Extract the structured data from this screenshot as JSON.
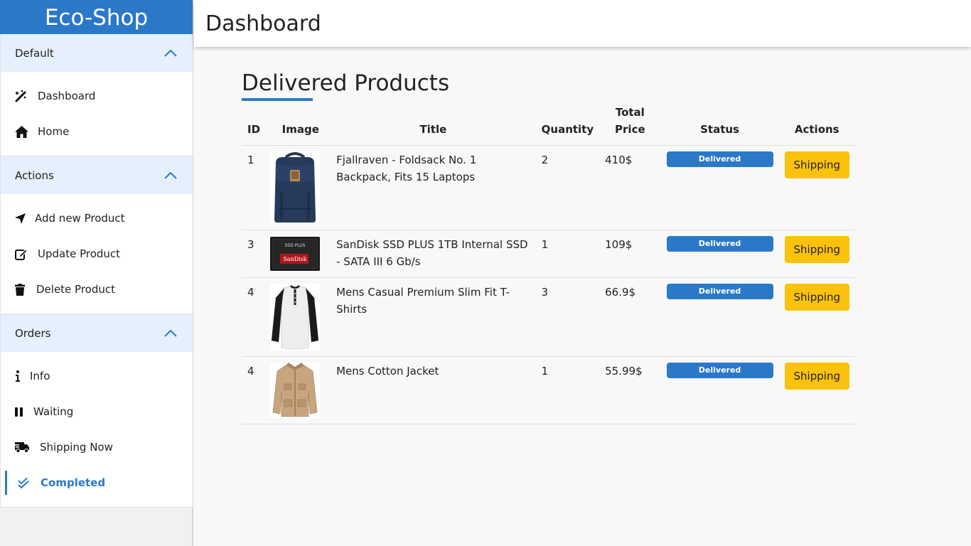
{
  "app": {
    "brand": "Eco-Shop",
    "page_title": "Dashboard"
  },
  "sidebar": {
    "sections": [
      {
        "title": "Default",
        "items": [
          {
            "label": "Dashboard",
            "icon": "magic-wand-icon"
          },
          {
            "label": "Home",
            "icon": "home-icon"
          }
        ]
      },
      {
        "title": "Actions",
        "items": [
          {
            "label": "Add new Product",
            "icon": "location-arrow-icon"
          },
          {
            "label": "Update Product",
            "icon": "edit-icon"
          },
          {
            "label": "Delete Product",
            "icon": "trash-icon"
          }
        ]
      },
      {
        "title": "Orders",
        "items": [
          {
            "label": "Info",
            "icon": "info-icon"
          },
          {
            "label": "Waiting",
            "icon": "pause-icon"
          },
          {
            "label": "Shipping Now",
            "icon": "truck-icon"
          },
          {
            "label": "Completed",
            "icon": "double-check-icon",
            "active": true
          }
        ]
      }
    ]
  },
  "main": {
    "heading": "Delivered Products",
    "columns": {
      "id": "ID",
      "image": "Image",
      "title": "Title",
      "quantity": "Quantity",
      "total_price_1": "Total",
      "total_price_2": "Price",
      "status": "Status",
      "actions": "Actions"
    },
    "rows": [
      {
        "id": "1",
        "image": "backpack",
        "title": "Fjallraven - Foldsack No. 1 Backpack, Fits 15 Laptops",
        "quantity": "2",
        "price": "410$",
        "status": "Delivered",
        "action": "Shipping"
      },
      {
        "id": "3",
        "image": "ssd",
        "title": "SanDisk SSD PLUS 1TB Internal SSD - SATA III 6 Gb/s",
        "quantity": "1",
        "price": "109$",
        "status": "Delivered",
        "action": "Shipping"
      },
      {
        "id": "4",
        "image": "tshirt",
        "title": "Mens Casual Premium Slim Fit T-Shirts",
        "quantity": "3",
        "price": "66.9$",
        "status": "Delivered",
        "action": "Shipping"
      },
      {
        "id": "4",
        "image": "jacket",
        "title": "Mens Cotton Jacket",
        "quantity": "1",
        "price": "55.99$",
        "status": "Delivered",
        "action": "Shipping"
      }
    ],
    "ssd_brand_text": "SanDisk",
    "ssd_model_text": "SSD PLUS"
  },
  "colors": {
    "accent": "#2b78c9",
    "header_bg": "#e6f0fc",
    "button": "#fbc20d"
  }
}
